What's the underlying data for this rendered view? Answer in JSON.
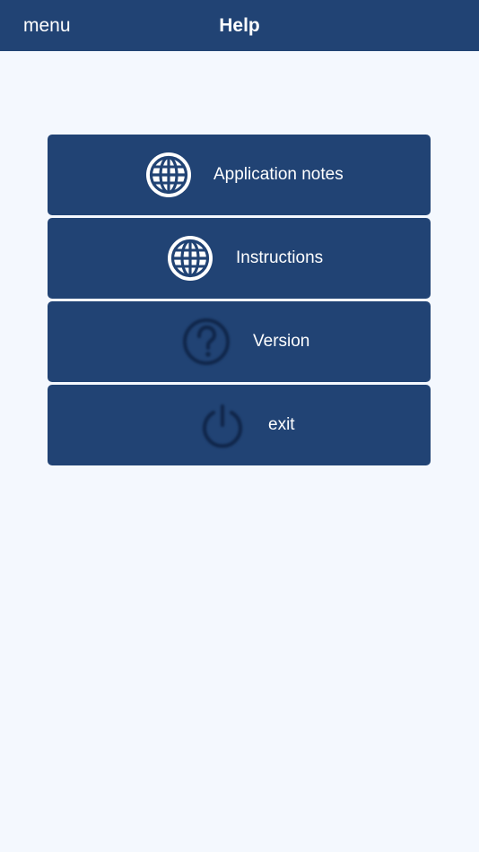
{
  "navbar": {
    "menu_label": "menu",
    "title": "Help"
  },
  "menu_items": [
    {
      "label": "Application notes",
      "icon": "globe-icon"
    },
    {
      "label": "Instructions",
      "icon": "globe-icon"
    },
    {
      "label": "Version",
      "icon": "question-circle-icon"
    },
    {
      "label": "exit",
      "icon": "power-icon"
    }
  ],
  "colors": {
    "navbar_bg": "#214374",
    "button_bg": "#214374",
    "page_bg": "#f4f8fe",
    "text": "#ffffff",
    "dim_icon": "#0f2340"
  }
}
